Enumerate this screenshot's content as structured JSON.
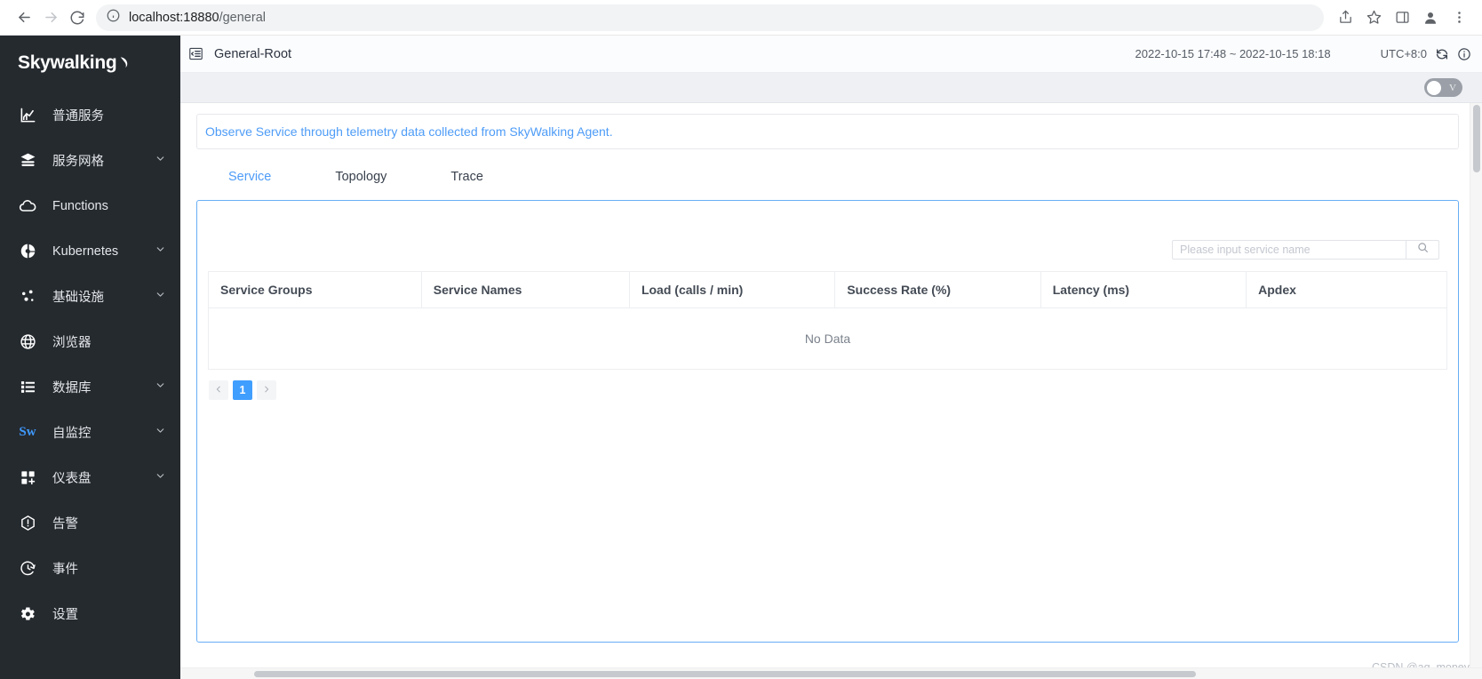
{
  "browser": {
    "back_icon": "arrow-left-icon",
    "forward_icon": "arrow-right-icon",
    "reload_icon": "reload-icon",
    "site_info_icon": "info-circle-icon",
    "url_host": "localhost:18880",
    "url_path": "/general",
    "share_icon": "share-icon",
    "bookmark_icon": "star-icon",
    "sidepanel_icon": "side-panel-icon",
    "profile_icon": "profile-icon",
    "menu_icon": "kebab-menu-icon"
  },
  "sidebar": {
    "brand": "Skywalking",
    "items": [
      {
        "label": "普通服务",
        "icon": "chart-bar-icon",
        "expandable": false
      },
      {
        "label": "服务网格",
        "icon": "mesh-layers-icon",
        "expandable": true
      },
      {
        "label": "Functions",
        "icon": "cloud-icon",
        "expandable": false
      },
      {
        "label": "Kubernetes",
        "icon": "kubernetes-icon",
        "expandable": true
      },
      {
        "label": "基础设施",
        "icon": "nodes-icon",
        "expandable": true
      },
      {
        "label": "浏览器",
        "icon": "globe-icon",
        "expandable": false
      },
      {
        "label": "数据库",
        "icon": "list-icon",
        "expandable": true
      },
      {
        "label": "自监控",
        "icon": "sw-logo-icon",
        "expandable": true
      },
      {
        "label": "仪表盘",
        "icon": "dashboard-add-icon",
        "expandable": true
      },
      {
        "label": "告警",
        "icon": "alarm-icon",
        "expandable": false
      },
      {
        "label": "事件",
        "icon": "event-clock-icon",
        "expandable": false
      },
      {
        "label": "设置",
        "icon": "gear-icon",
        "expandable": false
      }
    ]
  },
  "topbar": {
    "collapse_icon": "collapse-sidebar-icon",
    "title": "General-Root",
    "time_range": "2022-10-15 17:48 ~ 2022-10-15 18:18",
    "timezone": "UTC+8:0",
    "refresh_icon": "refresh-icon",
    "info_icon": "info-icon"
  },
  "subbar": {
    "toggle_label": "V",
    "toggle_on": false
  },
  "notice": {
    "text": "Observe Service through telemetry data collected from SkyWalking Agent."
  },
  "tabs": [
    {
      "label": "Service",
      "active": true
    },
    {
      "label": "Topology",
      "active": false
    },
    {
      "label": "Trace",
      "active": false
    }
  ],
  "search": {
    "value": "",
    "placeholder": "Please input service name",
    "button_icon": "search-icon"
  },
  "table": {
    "columns": [
      "Service Groups",
      "Service Names",
      "Load (calls / min)",
      "Success Rate (%)",
      "Latency (ms)",
      "Apdex"
    ],
    "rows": [],
    "empty_text": "No Data"
  },
  "pagination": {
    "prev_icon": "chevron-left-icon",
    "next_icon": "chevron-right-icon",
    "current_page": "1"
  },
  "watermark": {
    "text": "CSDN @aq_money"
  }
}
